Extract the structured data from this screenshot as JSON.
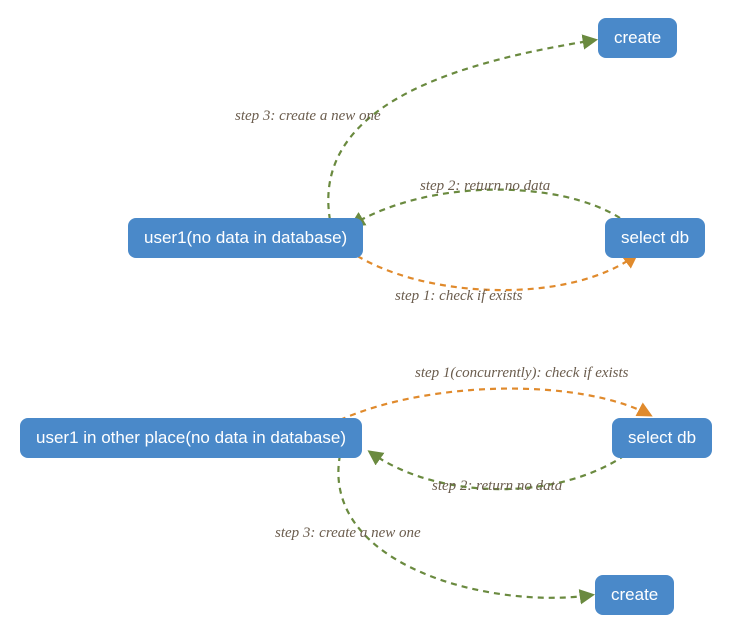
{
  "nodes": {
    "create_top": {
      "label": "create"
    },
    "user1_top": {
      "label": "user1(no data in database)"
    },
    "select_top": {
      "label": "select db"
    },
    "user1_bottom": {
      "label": "user1 in other place(no data in database)"
    },
    "select_bottom": {
      "label": "select db"
    },
    "create_bottom": {
      "label": "create"
    }
  },
  "edges": {
    "top_step1": {
      "label": "step 1: check if exists"
    },
    "top_step2": {
      "label": "step 2: return no data"
    },
    "top_step3": {
      "label": "step 3: create a new one"
    },
    "bottom_step1": {
      "label": "step 1(concurrently): check if exists"
    },
    "bottom_step2": {
      "label": "step 2: return no data"
    },
    "bottom_step3": {
      "label": "step 3: create a new one"
    }
  },
  "colors": {
    "node_fill": "#4a89c9",
    "edge_orange": "#e08a2c",
    "edge_green": "#6a8a3f",
    "label_text": "#6b5d4e"
  }
}
